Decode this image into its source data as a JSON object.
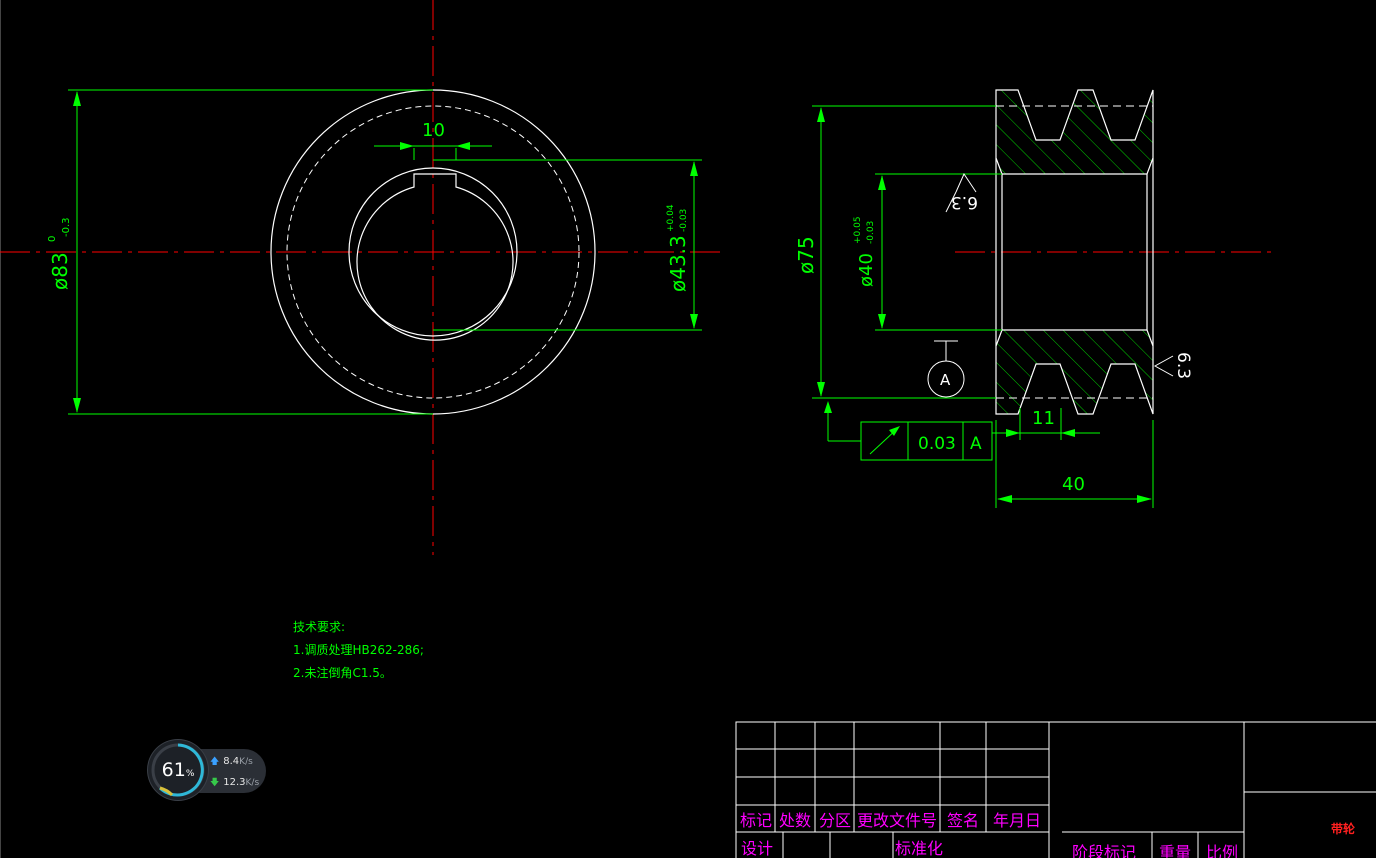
{
  "dimensions": {
    "keyway_width": "10",
    "outer_dia": "ø83",
    "outer_dia_tol_upper": "0",
    "outer_dia_tol_lower": "-0.3",
    "bore_dia": "ø43.3",
    "bore_tol_upper": "+0.04",
    "bore_tol_lower": "-0.03",
    "pulley_dia": "ø75",
    "pulley_bore": "ø40",
    "pulley_bore_tol_upper": "+0.05",
    "pulley_bore_tol_lower": "-0.03",
    "groove_width": "11",
    "total_width": "40",
    "roughness_1": "6.3",
    "roughness_2": "6.3",
    "datum": "A",
    "tolerance_value": "0.03",
    "tolerance_datum": "A"
  },
  "notes": {
    "title": "技术要求:",
    "line1": "1.调质处理HB262-286;",
    "line2": "2.未注倒角C1.5。"
  },
  "title_block": {
    "h_mark": "标记",
    "h_count": "处数",
    "h_zone": "分区",
    "h_doc": "更改文件号",
    "h_sign": "签名",
    "h_date": "年月日",
    "design": "设计",
    "standard": "标准化",
    "stage": "阶段标记",
    "weight": "重量",
    "scale": "比例",
    "part_name": "带轮"
  },
  "net_widget": {
    "percent": "61",
    "percent_unit": "%",
    "upload": "8.4",
    "download": "12.3",
    "unit": "K/s"
  },
  "colors": {
    "geometry": "#ffffff",
    "center_line": "#ff0000",
    "dimension": "#00ff00",
    "title_text": "#ff00ff",
    "part_name": "#ff0000"
  }
}
